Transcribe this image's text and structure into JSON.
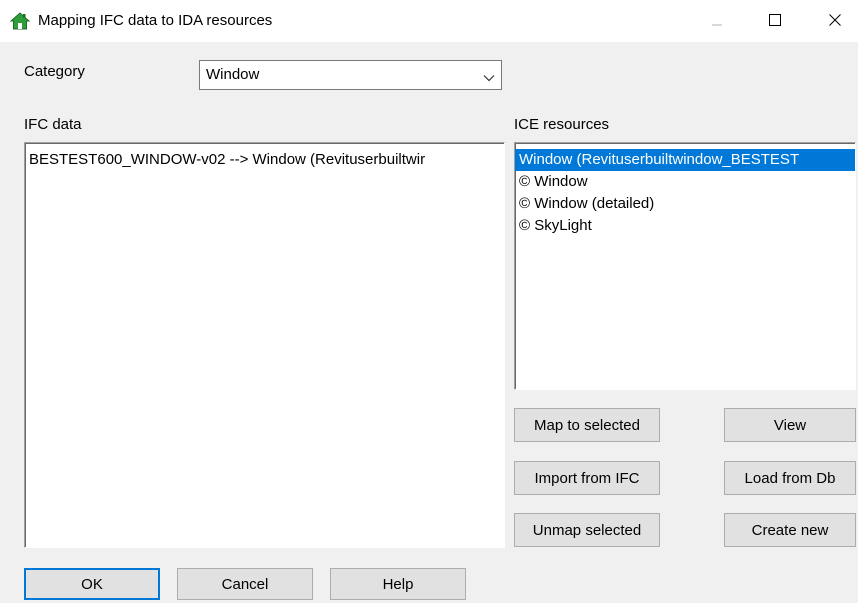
{
  "window": {
    "title": "Mapping IFC data to IDA resources",
    "icons": [
      "house-app-icon",
      "minimize-icon",
      "maximize-icon",
      "close-icon"
    ]
  },
  "category": {
    "label": "Category",
    "selected": "Window"
  },
  "ifc_data": {
    "label": "IFC data",
    "items": [
      "BESTEST600_WINDOW-v02 --> Window (Revituserbuiltwir"
    ]
  },
  "ice_resources": {
    "label": "ICE resources",
    "items": [
      "Window (Revituserbuiltwindow_BESTEST",
      "© Window",
      "© Window (detailed)",
      "© SkyLight"
    ],
    "selected_index": 0
  },
  "actions": {
    "map_to_selected": "Map to selected",
    "view": "View",
    "import_from_ifc": "Import from IFC",
    "load_from_db": "Load from Db",
    "unmap_selected": "Unmap selected",
    "create_new": "Create new"
  },
  "footer": {
    "ok": "OK",
    "cancel": "Cancel",
    "help": "Help"
  },
  "colors": {
    "selection": "#0078d7",
    "app_icon_green": "#2e9e3a",
    "window_bg": "#f0f0f0"
  }
}
